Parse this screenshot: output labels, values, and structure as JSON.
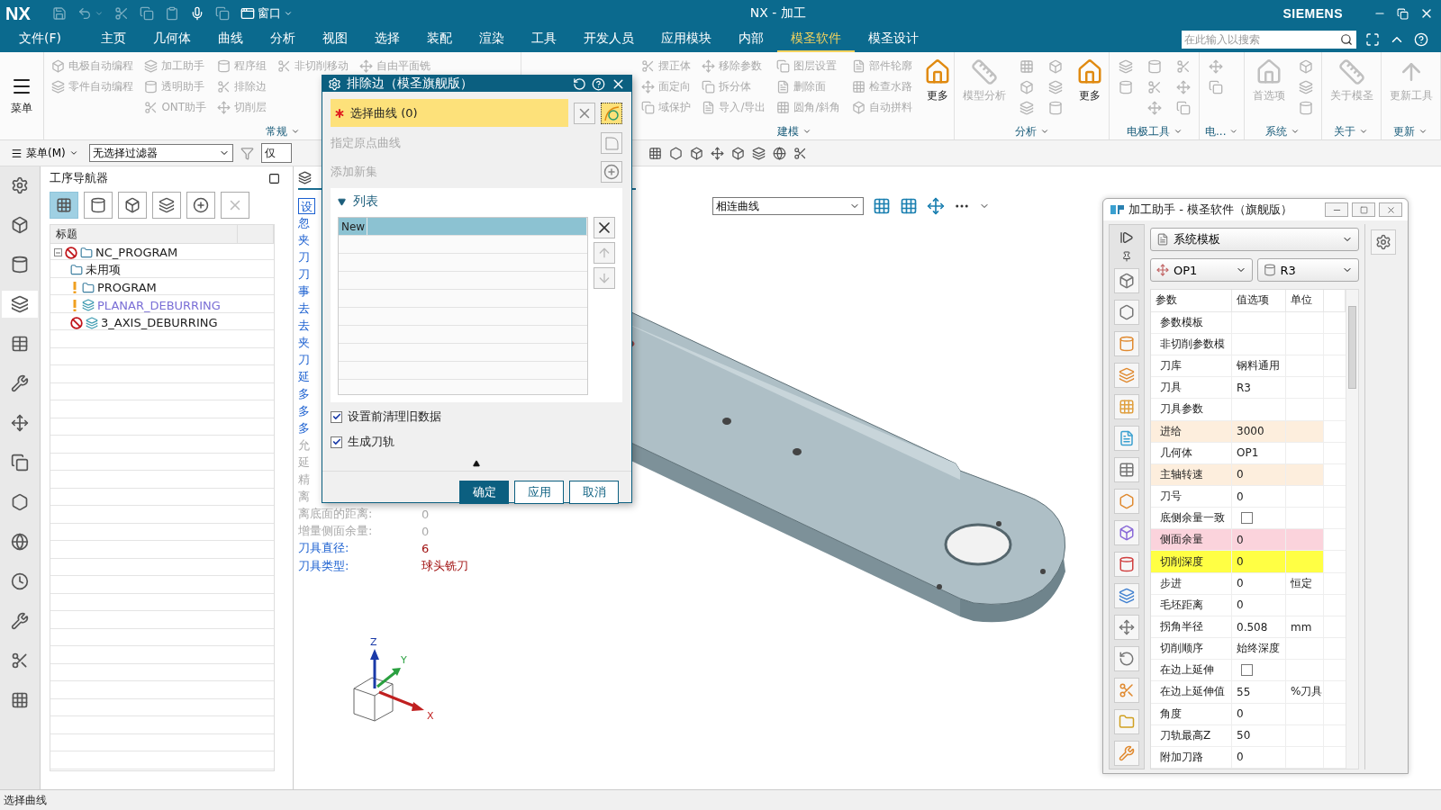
{
  "title_bar": {
    "app": "NX",
    "window_menu": "窗口",
    "title": "NX - 加工",
    "brand": "SIEMENS"
  },
  "menu_tabs": [
    {
      "label": "文件(F)",
      "selected": false
    },
    {
      "label": "主页",
      "selected": false
    },
    {
      "label": "几何体",
      "selected": false
    },
    {
      "label": "曲线",
      "selected": false
    },
    {
      "label": "分析",
      "selected": false
    },
    {
      "label": "视图",
      "selected": false
    },
    {
      "label": "选择",
      "selected": false
    },
    {
      "label": "装配",
      "selected": false
    },
    {
      "label": "渲染",
      "selected": false
    },
    {
      "label": "工具",
      "selected": false
    },
    {
      "label": "开发人员",
      "selected": false
    },
    {
      "label": "应用模块",
      "selected": false
    },
    {
      "label": "内部",
      "selected": false
    },
    {
      "label": "模圣软件",
      "selected": true
    },
    {
      "label": "模圣设计",
      "selected": false
    }
  ],
  "search": {
    "placeholder": "在此输入以搜索"
  },
  "ribbon": {
    "menu_button": "菜单",
    "groups": [
      {
        "label": "常规",
        "columns": [
          [
            {
              "kind": "small",
              "label": "电极自动编程",
              "disabled": true
            },
            {
              "kind": "small",
              "label": "零件自动编程",
              "disabled": true
            }
          ],
          [
            {
              "kind": "small",
              "label": "加工助手",
              "disabled": true
            },
            {
              "kind": "small",
              "label": "透明助手",
              "disabled": true
            },
            {
              "kind": "small",
              "label": "ONT助手",
              "disabled": true
            }
          ],
          [
            {
              "kind": "small",
              "label": "程序组",
              "disabled": true
            },
            {
              "kind": "small",
              "label": "排除边",
              "disabled": true
            },
            {
              "kind": "small",
              "label": "切削层",
              "disabled": true
            }
          ],
          [
            {
              "kind": "small",
              "label": "非切削移动",
              "disabled": true
            }
          ],
          [
            {
              "kind": "small",
              "label": "自由平面铣",
              "disabled": true
            }
          ]
        ]
      },
      {
        "label": "建模",
        "columns": [
          [
            {
              "kind": "small",
              "label": "摆正体",
              "disabled": true
            },
            {
              "kind": "small",
              "label": "面定向",
              "disabled": true
            },
            {
              "kind": "small",
              "label": "域保护",
              "disabled": true
            }
          ],
          [
            {
              "kind": "small",
              "label": "移除参数",
              "disabled": true
            },
            {
              "kind": "small",
              "label": "拆分体",
              "disabled": true
            },
            {
              "kind": "small",
              "label": "导入/导出",
              "disabled": true
            }
          ],
          [
            {
              "kind": "small",
              "label": "图层设置",
              "disabled": true
            },
            {
              "kind": "small",
              "label": "删除面",
              "disabled": true
            },
            {
              "kind": "small",
              "label": "圆角/斜角",
              "disabled": true
            }
          ],
          [
            {
              "kind": "small",
              "label": "部件轮廓",
              "disabled": true
            },
            {
              "kind": "small",
              "label": "检查水路",
              "disabled": true
            },
            {
              "kind": "small",
              "label": "自动拼料",
              "disabled": true
            }
          ],
          [
            {
              "kind": "large",
              "label": "更多",
              "disabled": false
            }
          ]
        ]
      },
      {
        "label": "分析",
        "columns": [
          [
            {
              "kind": "large",
              "label": "模型分析",
              "disabled": true
            }
          ],
          [
            {
              "kind": "icon",
              "disabled": true
            },
            {
              "kind": "icon",
              "disabled": true
            },
            {
              "kind": "icon",
              "disabled": true
            }
          ],
          [
            {
              "kind": "icon",
              "disabled": true
            },
            {
              "kind": "icon",
              "disabled": true
            },
            {
              "kind": "icon",
              "disabled": true
            }
          ],
          [
            {
              "kind": "large",
              "label": "更多",
              "disabled": false
            }
          ]
        ]
      },
      {
        "label": "电极工具",
        "columns": [
          [
            {
              "kind": "icon",
              "disabled": true
            },
            {
              "kind": "icon",
              "disabled": true
            }
          ],
          [
            {
              "kind": "icon",
              "disabled": true
            },
            {
              "kind": "icon",
              "disabled": true
            },
            {
              "kind": "icon",
              "disabled": true
            }
          ],
          [
            {
              "kind": "icon",
              "disabled": true
            },
            {
              "kind": "icon",
              "disabled": true
            },
            {
              "kind": "icon",
              "disabled": true
            }
          ]
        ]
      },
      {
        "label": "电...",
        "columns": [
          [
            {
              "kind": "icon",
              "disabled": true
            },
            {
              "kind": "icon",
              "disabled": true
            }
          ]
        ]
      },
      {
        "label": "系统",
        "columns": [
          [
            {
              "kind": "large",
              "label": "首选项",
              "disabled": true
            }
          ],
          [
            {
              "kind": "icon",
              "disabled": true
            },
            {
              "kind": "icon",
              "disabled": true
            },
            {
              "kind": "icon",
              "disabled": true
            }
          ]
        ]
      },
      {
        "label": "关于",
        "columns": [
          [
            {
              "kind": "large",
              "label": "关于模圣",
              "disabled": true
            }
          ]
        ]
      },
      {
        "label": "更新",
        "columns": [
          [
            {
              "kind": "large",
              "label": "更新工具",
              "disabled": true
            }
          ]
        ]
      }
    ]
  },
  "toolbar": {
    "menu": "菜单(M)",
    "filter": "无选择过滤器",
    "scope": "仅"
  },
  "rail": [
    {
      "selected": false
    },
    {
      "selected": false
    },
    {
      "selected": false
    },
    {
      "selected": true
    },
    {
      "selected": false
    },
    {
      "selected": false
    },
    {
      "selected": false
    },
    {
      "selected": false
    },
    {
      "selected": false
    },
    {
      "selected": false
    },
    {
      "selected": false
    },
    {
      "selected": false
    },
    {
      "selected": false
    },
    {
      "selected": false
    }
  ],
  "navigator": {
    "title": "工序导航器",
    "view_buttons": [
      {
        "selected": true,
        "disabled": false
      },
      {
        "selected": false,
        "disabled": false
      },
      {
        "selected": false,
        "disabled": false
      },
      {
        "selected": false,
        "disabled": false
      },
      {
        "selected": false,
        "disabled": false
      },
      {
        "selected": false,
        "disabled": true
      }
    ],
    "column": "标题",
    "tree": [
      {
        "label": "NC_PROGRAM",
        "kind": "group",
        "blocked": true,
        "warning": false,
        "expanded": true,
        "highlighted": false,
        "children": [
          {
            "label": "未用项",
            "kind": "group",
            "blocked": false,
            "warning": false,
            "highlighted": false
          },
          {
            "label": "PROGRAM",
            "kind": "group",
            "blocked": false,
            "warning": true,
            "highlighted": false
          },
          {
            "label": "PLANAR_DEBURRING",
            "kind": "operation",
            "blocked": false,
            "warning": true,
            "highlighted": true
          },
          {
            "label": "3_AXIS_DEBURRING",
            "kind": "operation",
            "blocked": true,
            "warning": false,
            "highlighted": false
          }
        ]
      }
    ]
  },
  "info": [
    {
      "kind": "button",
      "label": "设",
      "disabled": false
    },
    {
      "kind": "param",
      "label": "忽",
      "disabled": false
    },
    {
      "kind": "param",
      "label": "夹",
      "disabled": false
    },
    {
      "kind": "param",
      "label": "刀",
      "disabled": false
    },
    {
      "kind": "param",
      "label": "刀",
      "disabled": false
    },
    {
      "kind": "param",
      "label": "事",
      "disabled": false
    },
    {
      "kind": "param",
      "label": "去",
      "disabled": false
    },
    {
      "kind": "param",
      "label": "去",
      "disabled": false
    },
    {
      "kind": "param",
      "label": "夹",
      "disabled": false
    },
    {
      "kind": "param",
      "label": "刀",
      "disabled": false
    },
    {
      "kind": "param",
      "label": "延",
      "disabled": false
    },
    {
      "kind": "param",
      "label": "多",
      "disabled": false
    },
    {
      "kind": "param",
      "label": "多",
      "disabled": false
    },
    {
      "kind": "param",
      "label": "多",
      "disabled": false
    },
    {
      "kind": "param",
      "label": "允",
      "disabled": true
    },
    {
      "kind": "param",
      "label": "延",
      "disabled": true
    },
    {
      "kind": "param",
      "label": "精",
      "disabled": true
    },
    {
      "kind": "param",
      "label": "离",
      "disabled": true
    },
    {
      "kind": "param",
      "label": "离底面的距离:",
      "value": "0",
      "disabled": true
    },
    {
      "kind": "param",
      "label": "增量侧面余量:",
      "value": "0",
      "disabled": true
    },
    {
      "kind": "param",
      "label": "刀具直径:",
      "value": "6",
      "disabled": false
    },
    {
      "kind": "param",
      "label": "刀具类型:",
      "value": "球头铣刀",
      "disabled": false
    }
  ],
  "canvas_toolbar": {
    "curve_rule": "相连曲线"
  },
  "triad": {
    "z": "Z",
    "y": "Y",
    "x": "X"
  },
  "dialog": {
    "title": "排除边（模圣旗舰版）",
    "select": "选择曲线 (0)",
    "origin": "指定原点曲线",
    "add_set": "添加新集",
    "section": "列表",
    "section_expanded": true,
    "list": [
      {
        "name": "New",
        "selected": true
      }
    ],
    "options": [
      {
        "label": "设置前清理旧数据",
        "checked": true
      },
      {
        "label": "生成刀轨",
        "checked": true
      }
    ],
    "buttons": [
      {
        "label": "确定",
        "primary": true
      },
      {
        "label": "应用",
        "primary": false
      },
      {
        "label": "取消",
        "primary": false
      }
    ]
  },
  "assistant": {
    "title": "加工助手 - 模圣软件（旗舰版）",
    "template": "系统模板",
    "geometry": "OP1",
    "tool": "R3",
    "columns": [
      "参数",
      "值选项",
      "单位"
    ],
    "rows": [
      {
        "param": "参数模板",
        "kind": "text"
      },
      {
        "param": "非切削参数模",
        "kind": "text"
      },
      {
        "param": "刀库",
        "value": "钢料通用",
        "kind": "text"
      },
      {
        "param": "刀具",
        "value": "R3",
        "kind": "text"
      },
      {
        "param": "刀具参数",
        "kind": "text"
      },
      {
        "param": "进给",
        "value": "3000",
        "kind": "text",
        "color": "#fdeedd"
      },
      {
        "param": "几何体",
        "value": "OP1",
        "kind": "text"
      },
      {
        "param": "主轴转速",
        "value": "0",
        "kind": "text",
        "color": "#fdeedd"
      },
      {
        "param": "刀号",
        "value": "0",
        "kind": "text"
      },
      {
        "param": "底侧余量一致",
        "kind": "checkbox",
        "checked": false
      },
      {
        "param": "侧面余量",
        "value": "0",
        "kind": "text",
        "color": "#fbd3dc"
      },
      {
        "param": "切削深度",
        "value": "0",
        "kind": "text",
        "color": "#ffff44"
      },
      {
        "param": "步进",
        "value": "0",
        "unit": "恒定",
        "kind": "text"
      },
      {
        "param": "毛坯距离",
        "value": "0",
        "kind": "text"
      },
      {
        "param": "拐角半径",
        "value": "0.508",
        "unit": "mm",
        "kind": "text"
      },
      {
        "param": "切削顺序",
        "value": "始终深度",
        "kind": "text"
      },
      {
        "param": "在边上延伸",
        "kind": "checkbox",
        "checked": false
      },
      {
        "param": "在边上延伸值",
        "value": "55",
        "unit": "%刀具",
        "kind": "text"
      },
      {
        "param": "角度",
        "value": "0",
        "kind": "text"
      },
      {
        "param": "刀轨最高Z",
        "value": "50",
        "kind": "text"
      },
      {
        "param": "附加刀路",
        "value": "0",
        "kind": "text"
      }
    ]
  },
  "status_bar": "选择曲线"
}
